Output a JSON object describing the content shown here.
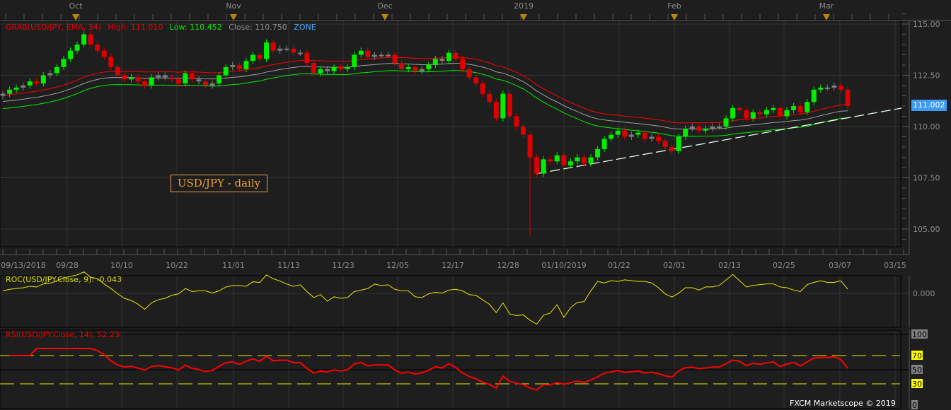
{
  "top_axis": {
    "months": [
      "Oct",
      "Nov",
      "Dec",
      "2019",
      "Feb",
      "Mar"
    ]
  },
  "legend": {
    "indicator": "GRAB(USD/JPY, EMA, 34)",
    "high": "High: 111.010",
    "low": "Low: 110.452",
    "close": "Close: 110.750",
    "zone": "ZONE"
  },
  "title_box": "USD/JPY - daily",
  "price_axis": {
    "labels": [
      "115.00",
      "112.50",
      "110.00",
      "107.50",
      "105.00"
    ],
    "current_price": "111.002"
  },
  "date_axis": {
    "labels": [
      "09/13/2018",
      "09/28",
      "10/10",
      "10/22",
      "11/01",
      "11/13",
      "11/23",
      "12/05",
      "12/17",
      "12/28",
      "01/10/2019",
      "01/22",
      "02/01",
      "02/13",
      "02/25",
      "03/07",
      "03/15"
    ]
  },
  "roc": {
    "label": "ROC(USD/JPY.Close, 9): -0.043",
    "axis_label": "0.000"
  },
  "rsi": {
    "label": "RSI(USD/JPY.Close, 14): 52.23",
    "axis_labels": [
      "100",
      "70",
      "50",
      "30",
      "0"
    ]
  },
  "footer": "FXCM Marketscope © 2019",
  "colors": {
    "up": "#00ee00",
    "down": "#dd0000",
    "neutral": "#808080",
    "ema_high": "#ff0000",
    "ema_close": "#a0a0a0",
    "ema_low": "#00ee00",
    "roc": "#e8e800",
    "rsi": "#ff0000",
    "levels": "#e8e800",
    "current": "#3d9bf5"
  },
  "chart_data": {
    "type": "candlestick",
    "symbol": "USD/JPY",
    "ylim": [
      104.5,
      115.5
    ],
    "closes": [
      111.6,
      111.8,
      111.9,
      112.0,
      112.2,
      112.1,
      112.5,
      112.6,
      112.9,
      113.3,
      113.7,
      114.0,
      114.5,
      114.0,
      113.7,
      113.4,
      112.9,
      112.5,
      112.3,
      112.4,
      112.2,
      112.0,
      112.4,
      112.5,
      112.4,
      112.3,
      112.1,
      112.6,
      112.3,
      112.2,
      112.0,
      112.1,
      112.5,
      112.9,
      113.0,
      112.8,
      113.2,
      113.5,
      113.3,
      114.1,
      113.7,
      113.8,
      113.8,
      113.6,
      113.6,
      113.1,
      112.6,
      112.8,
      112.7,
      112.9,
      112.8,
      112.9,
      113.5,
      113.7,
      113.4,
      113.5,
      113.5,
      113.5,
      113.1,
      112.8,
      112.9,
      112.7,
      112.8,
      113.0,
      113.3,
      113.2,
      113.6,
      113.3,
      112.8,
      112.4,
      112.1,
      111.6,
      111.2,
      110.4,
      111.6,
      110.5,
      110.0,
      109.6,
      108.5,
      107.7,
      108.4,
      108.3,
      108.6,
      108.1,
      108.3,
      108.5,
      108.2,
      108.5,
      108.9,
      109.4,
      109.6,
      109.8,
      109.5,
      109.6,
      109.7,
      109.4,
      109.5,
      109.3,
      109.0,
      108.8,
      109.5,
      109.9,
      110.0,
      109.8,
      109.9,
      110.0,
      110.0,
      110.4,
      110.9,
      110.8,
      110.4,
      110.7,
      110.6,
      110.8,
      110.9,
      110.5,
      110.8,
      111.0,
      110.7,
      111.2,
      111.8,
      111.9,
      111.9,
      112.0,
      111.8,
      111.0
    ],
    "first_open": 111.5,
    "flash_low": {
      "index": 78,
      "value": 104.7
    },
    "ema_period": 34,
    "trendline": {
      "start": {
        "index": 79,
        "value": 107.7
      },
      "end": {
        "index": 133,
        "value": 110.9
      }
    },
    "roc_period": 9,
    "rsi_period": 14,
    "rsi_levels": [
      70,
      50,
      30
    ]
  }
}
